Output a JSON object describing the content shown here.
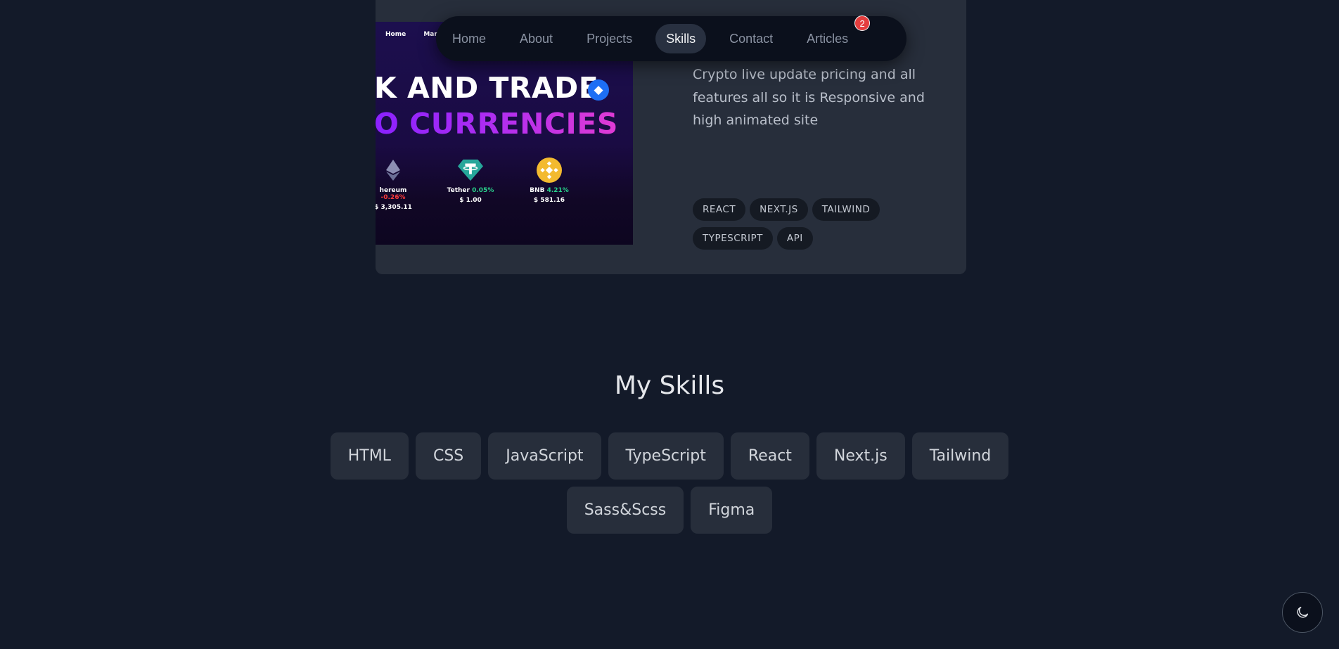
{
  "navbar": {
    "items": [
      {
        "label": "Home"
      },
      {
        "label": "About"
      },
      {
        "label": "Projects"
      },
      {
        "label": "Skills",
        "active": true
      },
      {
        "label": "Contact"
      },
      {
        "label": "Articles",
        "badge": "2"
      }
    ]
  },
  "project": {
    "preview": {
      "nav": [
        "Home",
        "Market"
      ],
      "headline_line1": "K AND TRADE",
      "headline_line2": "O CURRENCIES",
      "coins": [
        {
          "name": "hereum",
          "change": "-0.26%",
          "price": "$ 3,305.11",
          "trend": "down",
          "icon": "ethereum-icon"
        },
        {
          "name": "Tether",
          "change": "0.05%",
          "price": "$ 1.00",
          "trend": "up",
          "icon": "tether-icon"
        },
        {
          "name": "BNB",
          "change": "4.21%",
          "price": "$ 581.16",
          "trend": "up",
          "icon": "bnb-icon"
        }
      ]
    },
    "description": "Crypto live update pricing and all features all so it is Responsive and high animated site",
    "tags": [
      "REACT",
      "NEXT.JS",
      "TAILWIND",
      "TYPESCRIPT",
      "API"
    ]
  },
  "skills": {
    "title": "My Skills",
    "row1": [
      "HTML",
      "CSS",
      "JavaScript",
      "TypeScript",
      "React",
      "Next.js",
      "Tailwind"
    ],
    "row2": [
      "Sass&Scss",
      "Figma"
    ]
  },
  "theme_toggle": {
    "icon": "moon-icon"
  },
  "colors": {
    "background": "#131a29",
    "card": "#272e3b",
    "navbar": "#0b101c",
    "badge": "#e53e3e",
    "negative": "#ff3b3b",
    "positive": "#29d18c"
  }
}
